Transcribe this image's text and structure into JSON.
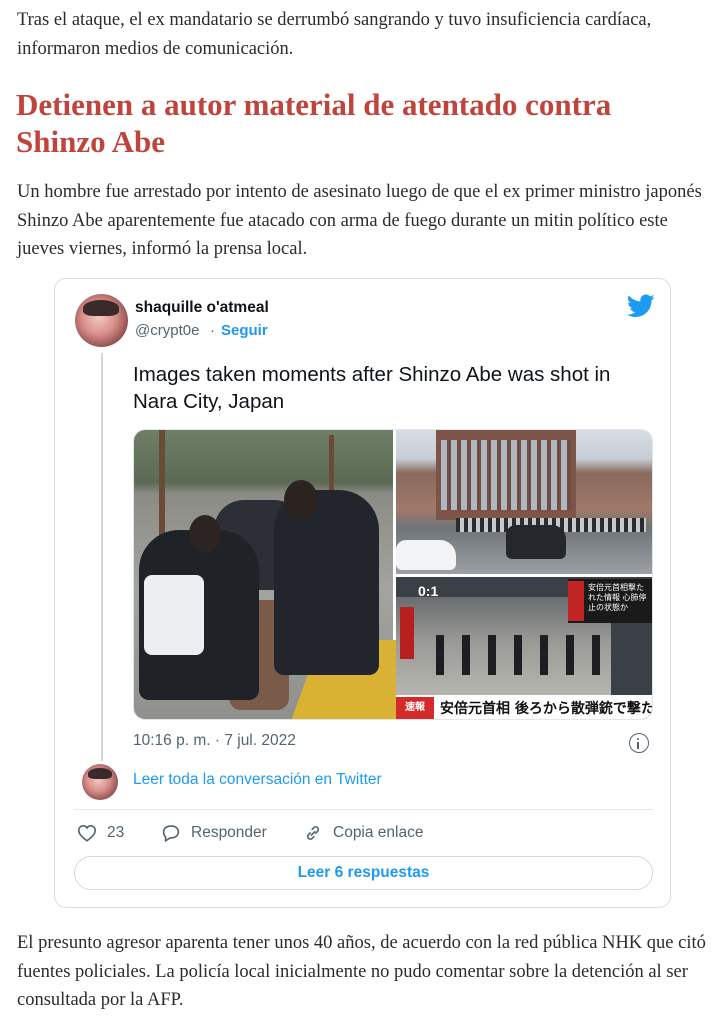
{
  "article": {
    "intro": "Tras el ataque, el ex mandatario se derrumbó sangrando y tuvo insuficiencia cardíaca, informaron medios de comunicación.",
    "headline": "Detienen a autor material de atentado contra Shinzo Abe",
    "lead": "Un hombre fue arrestado por intento de asesinato luego de que el ex primer ministro japonés Shinzo Abe aparentemente fue atacado con arma de fuego durante un mitin político este jueves viernes, informó la prensa local.",
    "outro": "El presunto agresor aparenta tener unos 40 años, de acuerdo con la red pública NHK que citó fuentes policiales. La policía local inicialmente no pudo comentar sobre la detención al ser consultada por la AFP."
  },
  "tweet": {
    "author_name": "shaquille o'atmeal",
    "handle": "@crypt0e",
    "separator": "·",
    "follow_label": "Seguir",
    "text": "Images taken moments after Shinzo Abe was shot in Nara City, Japan",
    "timestamp": "10:16 p. m. · 7 jul. 2022",
    "read_conversation": "Leer toda la conversación en Twitter",
    "likes": "23",
    "reply_label": "Responder",
    "copy_label": "Copia enlace",
    "read_replies": "Leer 6 respuestas",
    "media": {
      "clock": "0:1",
      "breaking_tag": "速報",
      "ticker": "安倍元首相 後ろから散弾銃で撃たれたか",
      "side_caption": "安倍元首相撃たれた情報 心肺停止の状態か"
    },
    "icons": {
      "brand": "twitter-bird-icon",
      "info": "info-icon",
      "like": "heart-icon",
      "reply": "comment-icon",
      "copy": "link-icon"
    },
    "colors": {
      "accent": "#1d9bf0",
      "muted": "#536471",
      "headline": "#c0443b"
    }
  }
}
